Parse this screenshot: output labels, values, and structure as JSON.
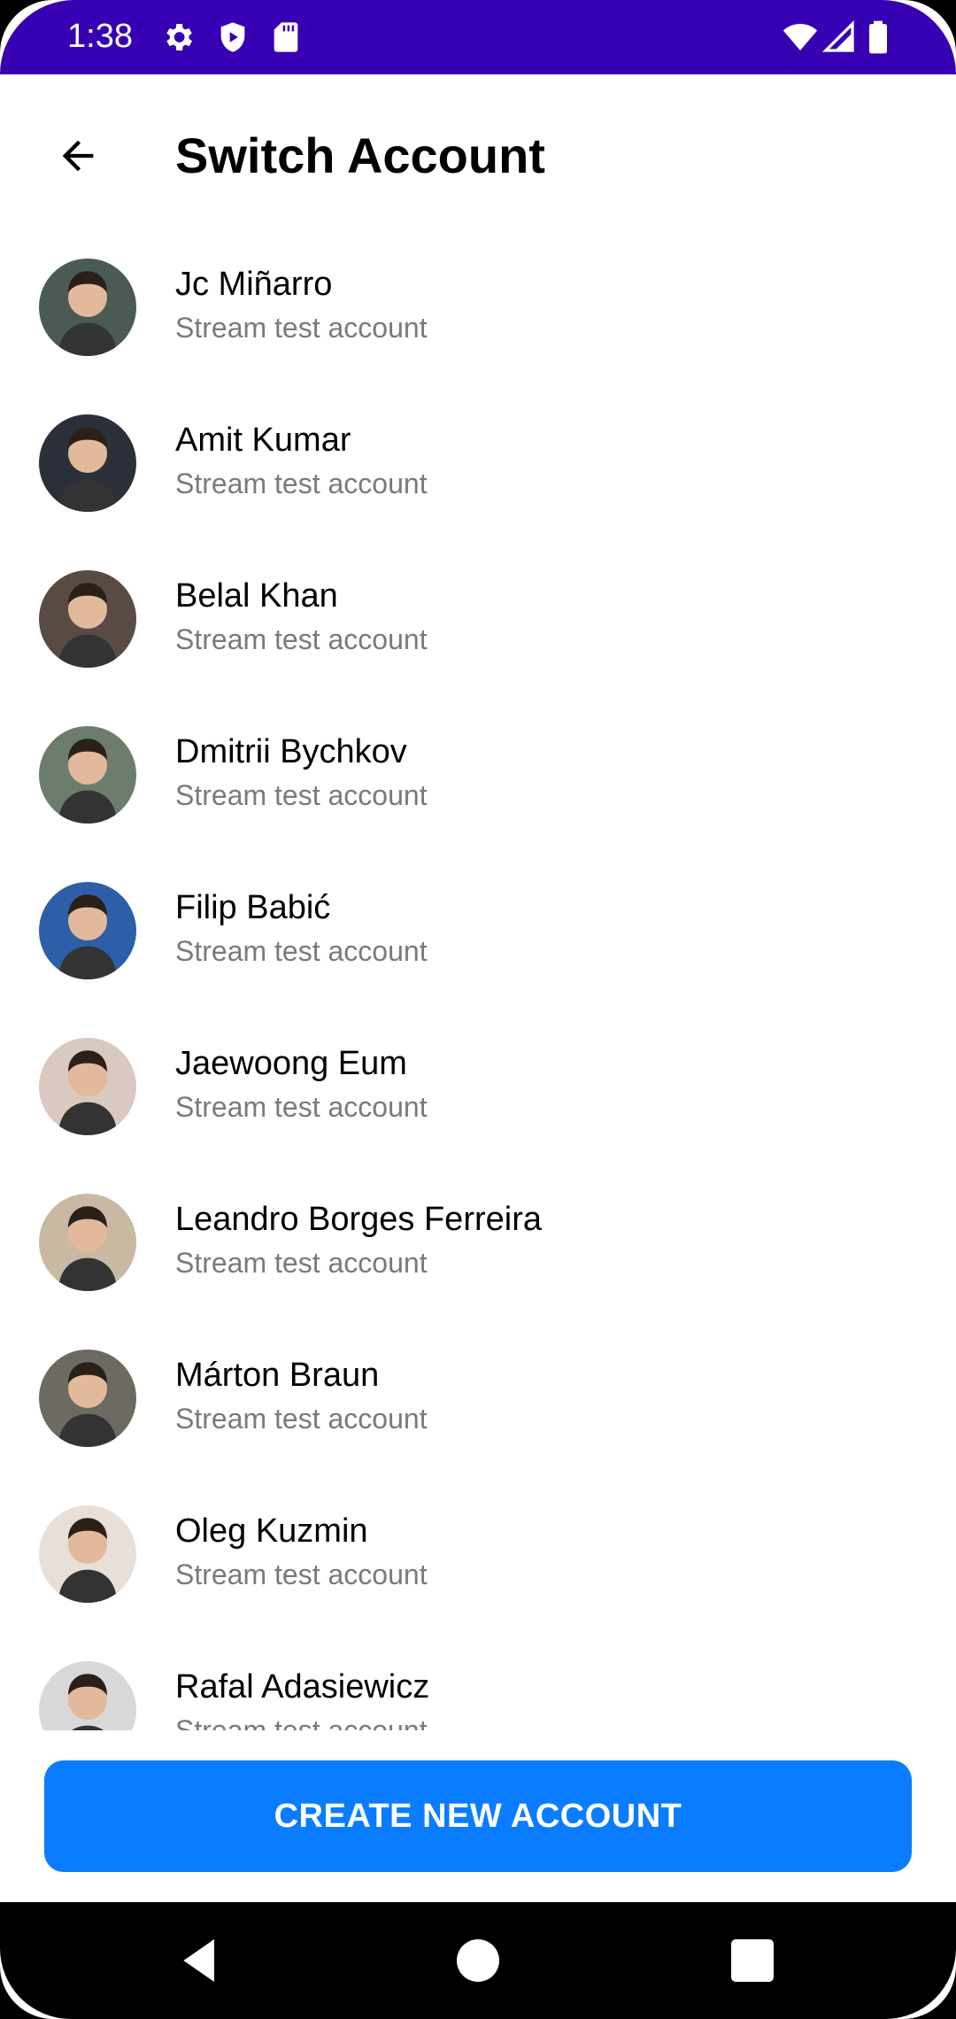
{
  "status_bar": {
    "time": "1:38",
    "icons_left": [
      "gear-icon",
      "shield-icon",
      "sd-card-icon"
    ],
    "icons_right": [
      "wifi-icon",
      "signal-icon",
      "battery-icon"
    ],
    "background": "#3700B3"
  },
  "app_bar": {
    "title": "Switch Account",
    "back_icon": "arrow-left-icon"
  },
  "accounts": [
    {
      "name": "Jc Miñarro",
      "subtitle": "Stream test account",
      "avatar_color": "#4a5a55"
    },
    {
      "name": "Amit Kumar",
      "subtitle": "Stream test account",
      "avatar_color": "#2b2f3a"
    },
    {
      "name": "Belal Khan",
      "subtitle": "Stream test account",
      "avatar_color": "#5a4a44"
    },
    {
      "name": "Dmitrii Bychkov",
      "subtitle": "Stream test account",
      "avatar_color": "#6c7d6e"
    },
    {
      "name": "Filip Babić",
      "subtitle": "Stream test account",
      "avatar_color": "#2d5fa8"
    },
    {
      "name": "Jaewoong Eum",
      "subtitle": "Stream test account",
      "avatar_color": "#d9c9c0"
    },
    {
      "name": "Leandro Borges Ferreira",
      "subtitle": "Stream test account",
      "avatar_color": "#c9b9a3"
    },
    {
      "name": "Márton Braun",
      "subtitle": "Stream test account",
      "avatar_color": "#6d6a62"
    },
    {
      "name": "Oleg Kuzmin",
      "subtitle": "Stream test account",
      "avatar_color": "#e8e0d8"
    },
    {
      "name": "Rafal Adasiewicz",
      "subtitle": "Stream test account",
      "avatar_color": "#d8d8d8"
    }
  ],
  "create_button": {
    "label": "CREATE NEW ACCOUNT",
    "color": "#0a7cff"
  },
  "nav_bar": {
    "back": "nav-back-icon",
    "home": "nav-home-icon",
    "recents": "nav-recents-icon"
  }
}
